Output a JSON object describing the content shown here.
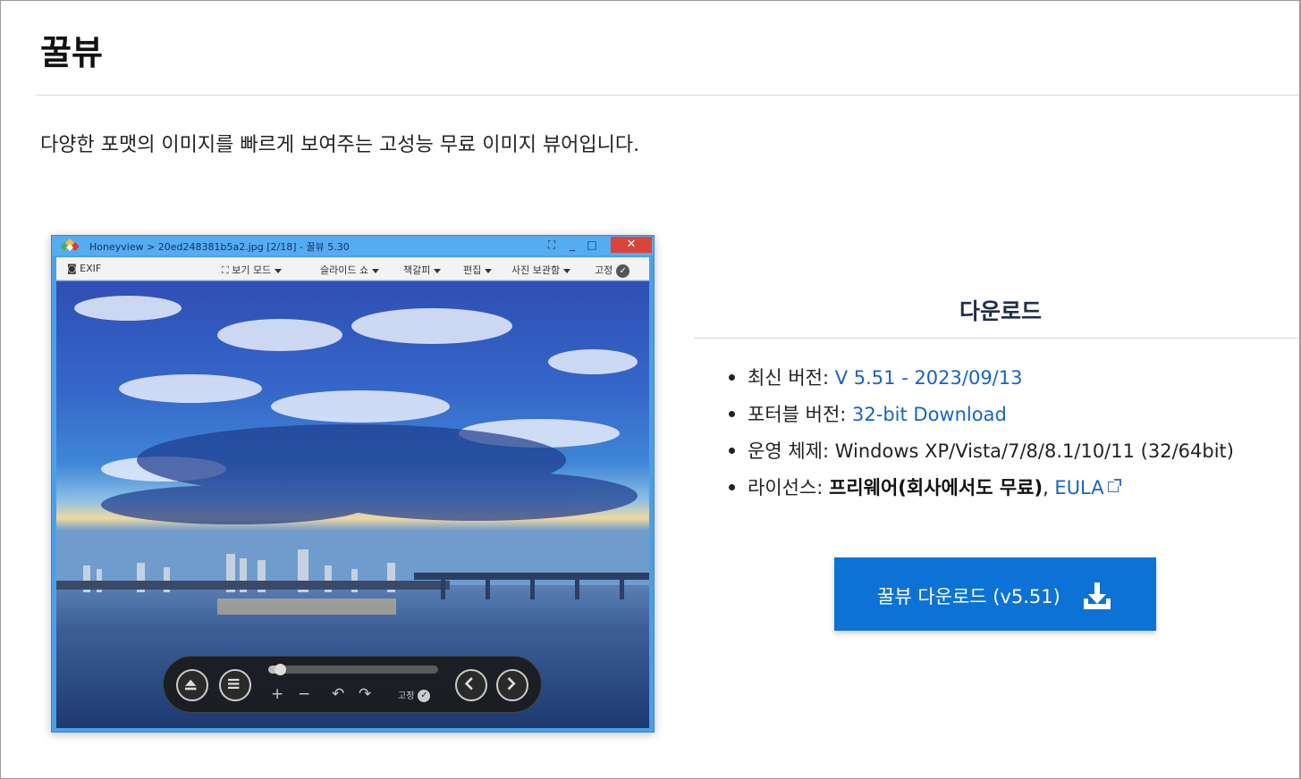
{
  "page": {
    "title": "꿀뷰",
    "description": "다양한 포맷의 이미지를 빠르게 보여주는 고성능 무료 이미지 뷰어입니다."
  },
  "app_screenshot": {
    "titlebar": {
      "app_name": "Honeyview",
      "path_text": "Honeyview > 20ed248381b5a2.jpg [2/18] - 꿀뷰 5.30",
      "minimize": "_",
      "maximize": "□",
      "close": "✕"
    },
    "menu": {
      "exif": "EXIF",
      "items": [
        "보기 모드",
        "슬라이드 쇼",
        "책갈피",
        "편집",
        "사진 보관함"
      ],
      "fix": "고정"
    },
    "controls": {
      "progress": 0.07,
      "fix": "고정",
      "zoom_in": "+",
      "zoom_out": "−",
      "rotate_left": "↶",
      "rotate_right": "↷"
    }
  },
  "download": {
    "heading": "다운로드",
    "latest_label": "최신 버전: ",
    "latest_value": "V 5.51 - 2023/09/13",
    "portable_label": "포터블 버전: ",
    "portable_value": "32-bit Download",
    "os_label": "운영 체제: ",
    "os_value": "Windows XP/Vista/7/8/8.1/10/11 (32/64bit)",
    "license_label": "라이선스: ",
    "license_value": "프리웨어(회사에서도 무료)",
    "license_sep": ", ",
    "eula": "EULA",
    "button_label": "꿀뷰 다운로드 (v5.51)",
    "button_icon": "download-icon",
    "colors": {
      "button": "#0c72d6",
      "link": "#1763c2"
    }
  }
}
